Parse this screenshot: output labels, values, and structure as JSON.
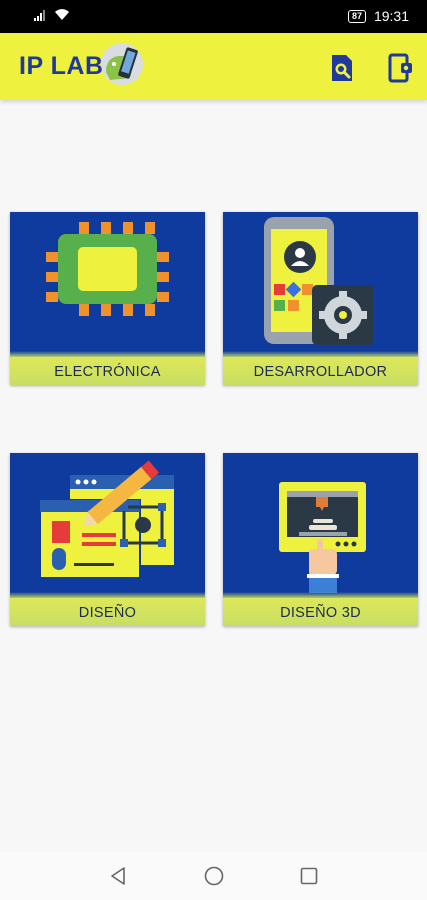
{
  "status": {
    "time": "19:31",
    "battery": "87"
  },
  "app": {
    "title": "IP LAB"
  },
  "cards": [
    {
      "label": "ELECTRÓNICA"
    },
    {
      "label": "DESARROLLADOR"
    },
    {
      "label": "DISEÑO"
    },
    {
      "label": "DISEÑO 3D"
    }
  ],
  "colors": {
    "appbar": "#eef13d",
    "card_bg": "#0f3b9f",
    "title": "#1f3a9c",
    "label_bg": "#c8de63"
  },
  "icons": {
    "appbar": [
      "search-document-icon",
      "exit-icon"
    ],
    "nav": [
      "back-icon",
      "home-icon",
      "recent-apps-icon"
    ]
  }
}
